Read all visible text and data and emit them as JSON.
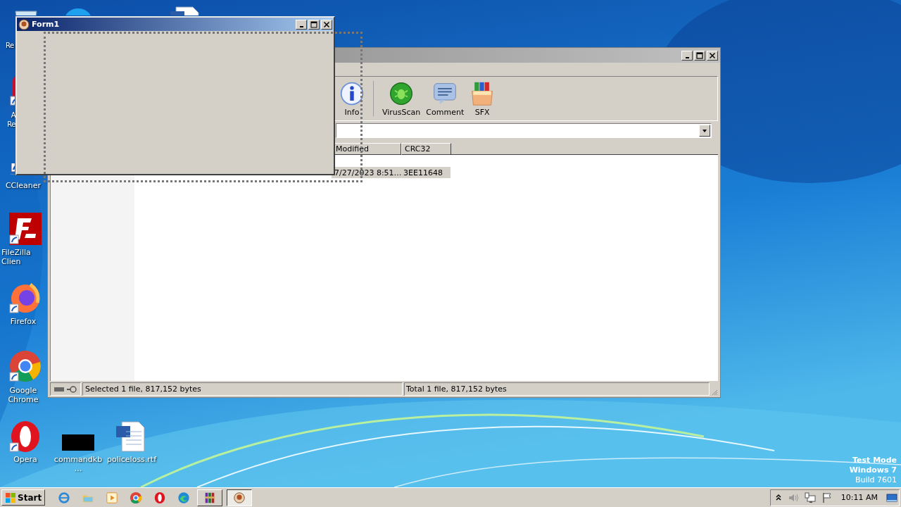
{
  "desktop_icons": [
    {
      "kind": "recycle-bin",
      "label": "Re"
    },
    {
      "kind": "skype"
    },
    {
      "kind": "word-doc"
    },
    {
      "kind": "acrobat",
      "label": "A Re"
    },
    {
      "kind": "ccleaner",
      "label": "CCleaner"
    },
    {
      "kind": "filezilla",
      "label": "FileZilla Clien"
    },
    {
      "kind": "firefox",
      "label": "Firefox"
    },
    {
      "kind": "chrome",
      "label": "Google Chrome"
    },
    {
      "kind": "opera",
      "label": "Opera"
    },
    {
      "kind": "black-window",
      "label": "commandkb…"
    },
    {
      "kind": "word-doc",
      "label": "policeloss.rtf"
    }
  ],
  "archiver_window": {
    "toolbar": [
      {
        "kind": "info",
        "label": "Info"
      },
      {
        "kind": "virusscan",
        "label": "VirusScan"
      },
      {
        "kind": "comment",
        "label": "Comment"
      },
      {
        "kind": "sfx",
        "label": "SFX"
      }
    ],
    "columns": [
      "Modified",
      "CRC32"
    ],
    "rows": [
      {
        "modified": "7/27/2023 8:51…",
        "crc32": "3EE11648",
        "selected": true
      }
    ],
    "status_bar": {
      "left": "Selected 1 file, 817,152 bytes",
      "right": "Total 1 file, 817,152 bytes"
    }
  },
  "form_window": {
    "title": "Form1"
  },
  "desktop_notice": [
    "Test Mode",
    "Windows 7",
    "Build 7601"
  ],
  "taskbar": {
    "start": "Start",
    "apps": [
      {
        "kind": "ie",
        "selected": false,
        "window_button": false
      },
      {
        "kind": "explorer",
        "selected": false,
        "window_button": false
      },
      {
        "kind": "media",
        "selected": false,
        "window_button": false
      },
      {
        "kind": "chrome",
        "selected": false,
        "window_button": false
      },
      {
        "kind": "opera",
        "selected": false,
        "window_button": false
      },
      {
        "kind": "edge",
        "selected": false,
        "window_button": false
      },
      {
        "kind": "winrar",
        "selected": false,
        "window_button": true
      },
      {
        "kind": "form",
        "selected": true,
        "window_button": true
      }
    ],
    "clock": "10:11 AM"
  }
}
